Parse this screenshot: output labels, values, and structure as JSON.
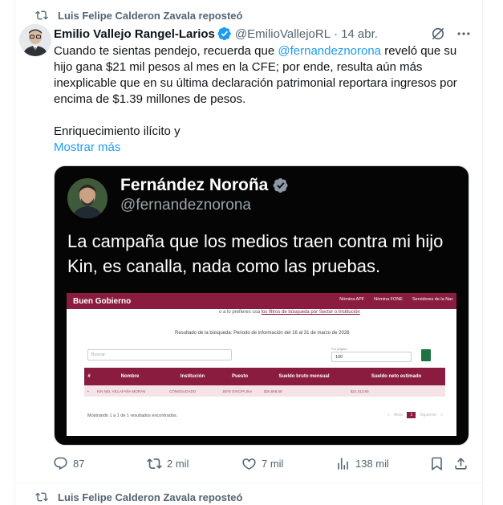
{
  "top_repost": {
    "text": "Luis Felipe Calderon Zavala reposteó",
    "icon": "repost-icon"
  },
  "tweet": {
    "author_name": "Emilio Vallejo Rangel-Larios",
    "handle": "@EmilioVallejoRL",
    "separator": "·",
    "date": "14 abr.",
    "text_before_mention": "Cuando te sientas pendejo, recuerda que ",
    "mention": "@fernandeznorona",
    "text_after_mention": " reveló que su hijo gana $21 mil pesos al mes en la CFE; por ende, resulta aún más inexplicable que en su última declaración patrimonial reportara ingresos por encima de $1.39 millones de pesos.",
    "text_paragraph2": "Enriquecimiento ilícito y",
    "show_more": "Mostrar más"
  },
  "media": {
    "quoted_name": "Fernández Noroña",
    "quoted_handle": "@fernandeznorona",
    "quoted_text": "La campaña que los medios traen contra mi hijo Kin, es canalla, nada como las pruebas.",
    "gov": {
      "brand": "Buen Gobierno",
      "nav": [
        "Nómina APF",
        "Nómina FONE",
        "Servidores de la Nac"
      ],
      "filter_prefix": "o a lo prefieres usa ",
      "filter_link": "los filtros de búsqueda por Sector o Institución",
      "result_label": "Resultado de la búsqueda:",
      "result_period": "Periodo de información del 16 al 31 de marzo de 2026",
      "search_placeholder": "Buscar",
      "per_page_label": "Por página",
      "per_page_value": "100",
      "columns": [
        "#",
        "Nombre",
        "Institución",
        "Puesto",
        "Sueldo bruto mensual",
        "Sueldo neto estimado"
      ],
      "row": [
        "•",
        "KIN NEL VILLAFAÑA MORÁN",
        "CONSOLIDADO",
        "JEFE DISCIPLINA",
        "$26,658.58",
        "$21,313.60"
      ],
      "footer": "Mostrando 1 a 1 de 1 resultados encontrados.",
      "pager": [
        "«",
        "Atrás",
        "1",
        "Siguiente",
        "»"
      ]
    }
  },
  "actions": {
    "replies": "87",
    "reposts": "2 mil",
    "likes": "7 mil",
    "views": "138 mil"
  },
  "bottom_repost": {
    "text": "Luis Felipe Calderon Zavala reposteó"
  },
  "colors": {
    "link": "#1d9bf0",
    "muted": "#536471",
    "gov_brand": "#8a1c3f"
  }
}
